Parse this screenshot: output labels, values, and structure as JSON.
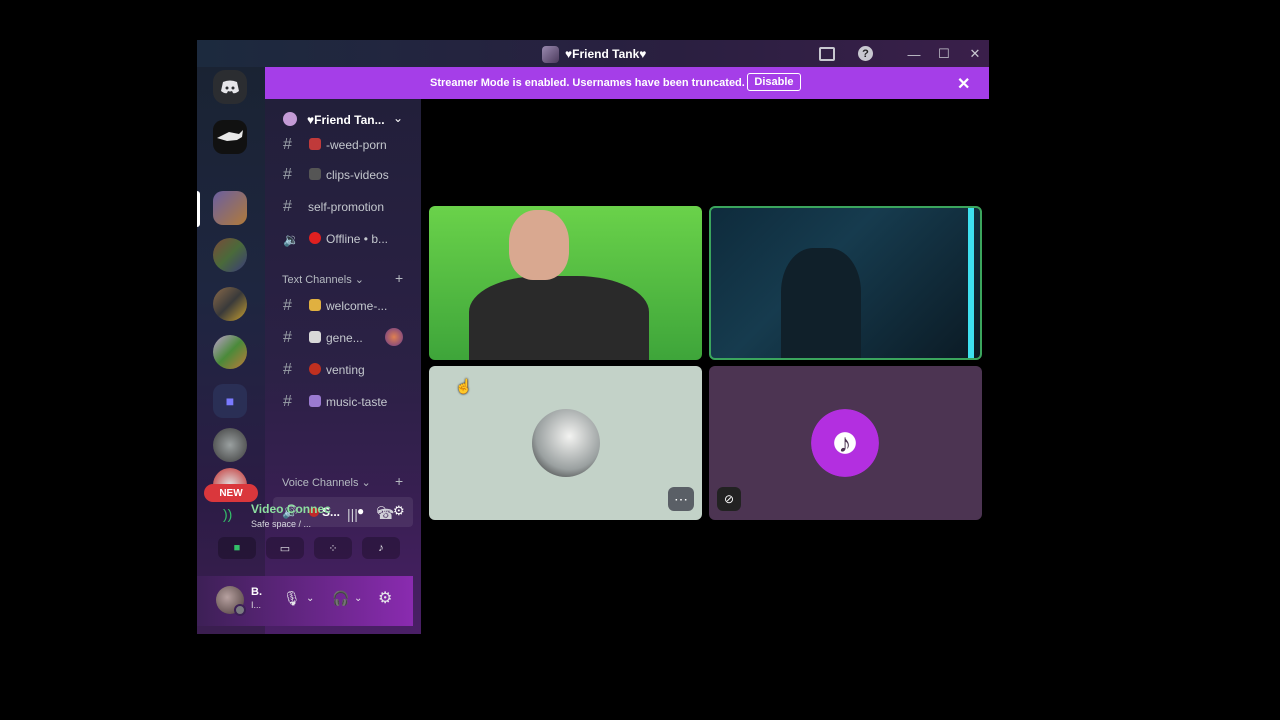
{
  "window": {
    "title": "♥Friend Tank♥"
  },
  "banner": {
    "text": "Streamer Mode is enabled. Usernames have been truncated.",
    "button": "Disable"
  },
  "guild": {
    "name": "♥Friend Tan..."
  },
  "channels_top": [
    {
      "label": "-weed-porn"
    },
    {
      "label": "clips-videos"
    },
    {
      "label": "self-promotion"
    },
    {
      "label": "Offline • b..."
    }
  ],
  "text_category": "Text Channels",
  "text_channels": [
    {
      "label": "welcome-..."
    },
    {
      "label": "gene..."
    },
    {
      "label": "venting"
    },
    {
      "label": "music-taste"
    }
  ],
  "voice_category": "Voice Channels",
  "voice_channel": {
    "label": "S..."
  },
  "voice_status": {
    "title": "Video Connec",
    "subtitle": "Safe space / ..."
  },
  "user": {
    "name": "B.",
    "sub": "I..."
  },
  "new_badge": "NEW"
}
